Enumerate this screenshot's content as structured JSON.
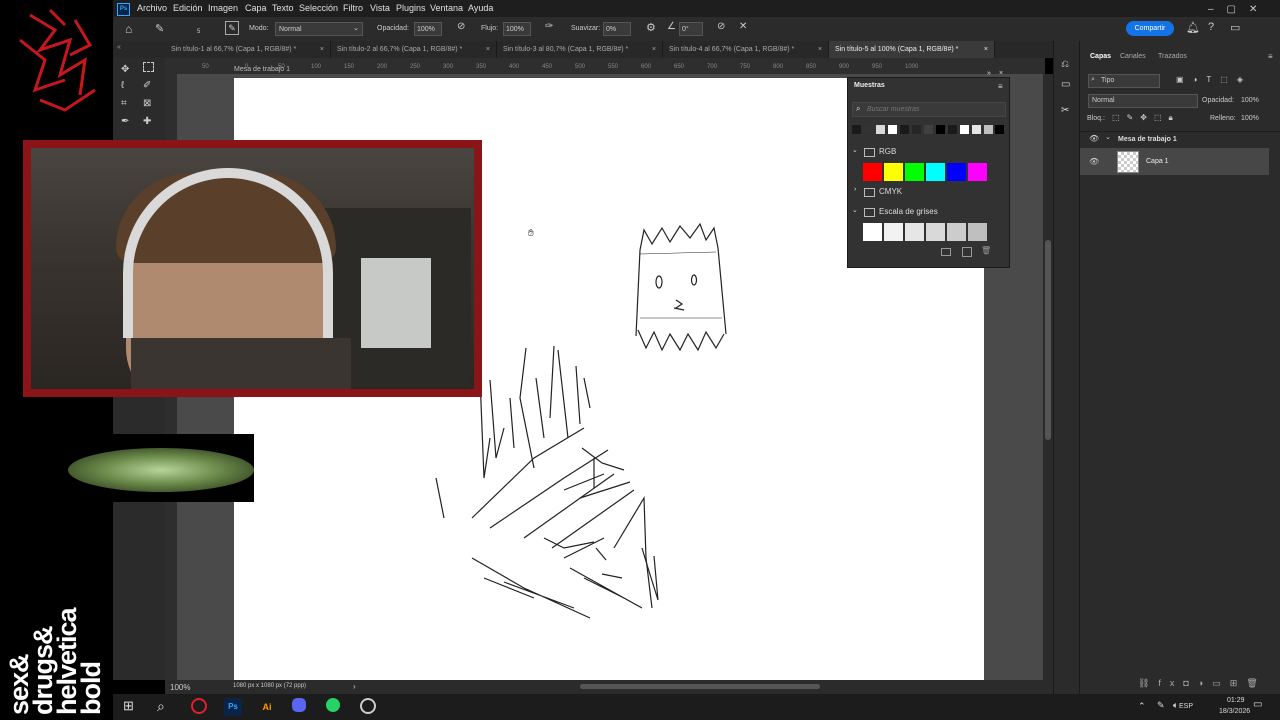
{
  "menu": {
    "logo": "Ps",
    "items": [
      "Archivo",
      "Edición",
      "Imagen",
      "Capa",
      "Texto",
      "Selección",
      "Filtro",
      "Vista",
      "Plugins",
      "Ventana",
      "Ayuda"
    ],
    "share_label": "Compartir"
  },
  "options": {
    "mode_label": "Modo:",
    "mode_value": "Normal",
    "opacity_label": "Opacidad:",
    "opacity_value": "100%",
    "flow_label": "Flujo:",
    "flow_value": "100%",
    "smooth_label": "Suavizar:",
    "smooth_value": "0%",
    "angle_value": "0°",
    "brush_size": "5"
  },
  "tabs": [
    {
      "label": "Sin título-1 al 66,7% (Capa 1, RGB/8#) *",
      "active": false
    },
    {
      "label": "Sin título-2 al 66,7% (Capa 1, RGB/8#) *",
      "active": false
    },
    {
      "label": "Sin título-3 al 80,7% (Capa 1, RGB/8#) *",
      "active": false
    },
    {
      "label": "Sin título-4 al 66,7% (Capa 1, RGB/8#) *",
      "active": false
    },
    {
      "label": "Sin título-5 al 100% (Capa 1, RGB/8#) *",
      "active": true
    }
  ],
  "ruler_ticks": [
    "50",
    "0",
    "50",
    "100",
    "150",
    "200",
    "250",
    "300",
    "350",
    "400",
    "450",
    "500",
    "550",
    "600",
    "650",
    "700",
    "750",
    "800",
    "850",
    "900",
    "950",
    "1000"
  ],
  "artboard_label": "Mesa de trabajo 1",
  "status": {
    "zoom": "100%",
    "doc_size": "1080 px x 1080 px (72 ppp)"
  },
  "swatches_panel": {
    "title": "Muestras",
    "search_placeholder": "Buscar muestras",
    "recent": [
      "#1a1a1a",
      "#333333",
      "#d9d9d9",
      "#ffffff",
      "#1a1a1a",
      "#262626",
      "#404040",
      "#000000",
      "#1a1a1a",
      "#ffffff",
      "#e6e6e6",
      "#bfbfbf",
      "#000000"
    ],
    "groups": [
      {
        "name": "RGB",
        "open": true,
        "colors": [
          "#ff0000",
          "#ffff00",
          "#00ff00",
          "#00ffff",
          "#0000ff",
          "#ff00ff"
        ]
      },
      {
        "name": "CMYK",
        "open": false,
        "colors": []
      },
      {
        "name": "Escala de grises",
        "open": true,
        "colors": [
          "#ffffff",
          "#f2f2f2",
          "#e6e6e6",
          "#d9d9d9",
          "#cccccc",
          "#bfbfbf"
        ]
      }
    ]
  },
  "layers_panel": {
    "tabs": [
      "Capas",
      "Canales",
      "Trazados"
    ],
    "filter_label": "Tipo",
    "blend_mode": "Normal",
    "opacity_label": "Opacidad:",
    "opacity_value": "100%",
    "lock_label": "Bloq.:",
    "fill_label": "Relleno:",
    "fill_value": "100%",
    "artboard_name": "Mesa de trabajo 1",
    "layer_name": "Capa 1"
  },
  "overlay": {
    "vertical_text": [
      "sex&",
      "drugs&",
      "helvetica",
      "bold"
    ]
  },
  "taskbar": {
    "language": "ESP",
    "time": "01:29",
    "date": "18/3/2026"
  }
}
